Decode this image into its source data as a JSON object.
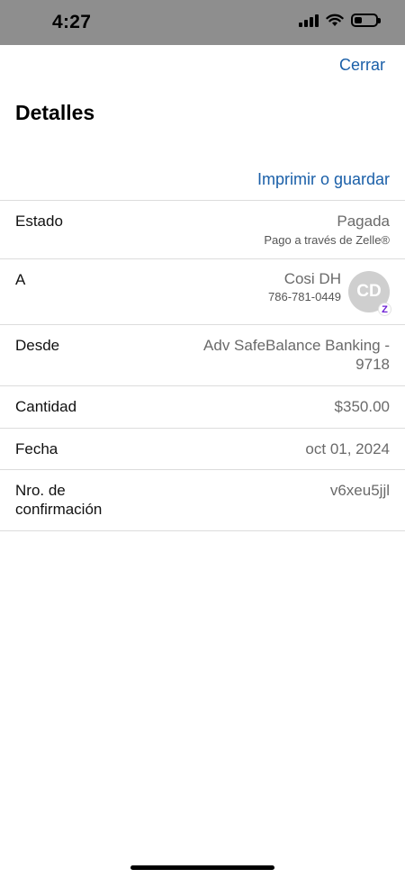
{
  "status_bar": {
    "time": "4:27",
    "battery_level": 0.35
  },
  "nav": {
    "close_label": "Cerrar"
  },
  "header": {
    "title": "Detalles"
  },
  "actions": {
    "print_label": "Imprimir o guardar"
  },
  "details": {
    "estado": {
      "label": "Estado",
      "value": "Pagada",
      "sub": "Pago a través de Zelle®"
    },
    "a": {
      "label": "A",
      "name": "Cosi DH",
      "phone": "786-781-0449",
      "avatar_initials": "CD",
      "badge_glyph": "Z"
    },
    "desde": {
      "label": "Desde",
      "value_line1": "Adv SafeBalance Banking -",
      "value_line2": "9718"
    },
    "cantidad": {
      "label": "Cantidad",
      "value": "$350.00"
    },
    "fecha": {
      "label": "Fecha",
      "value": "oct 01, 2024"
    },
    "confirmacion": {
      "label_line1": "Nro. de",
      "label_line2": "confirmación",
      "value": "v6xeu5jjl"
    }
  },
  "colors": {
    "link": "#1a5fa8",
    "status_bar_bg": "#8e8e8e",
    "zelle_purple": "#6d1ed4"
  }
}
